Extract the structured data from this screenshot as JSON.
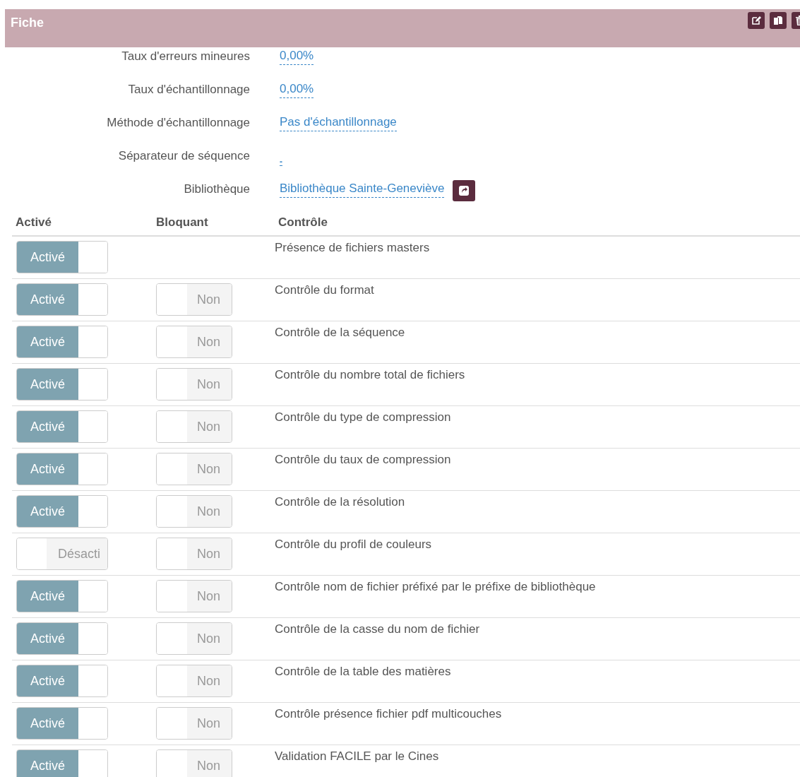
{
  "panel": {
    "title": "Fiche"
  },
  "fields": [
    {
      "label": "Taux d'erreurs mineures",
      "value": "0,00%",
      "has_button": false
    },
    {
      "label": "Taux d'échantillonnage",
      "value": "0,00%",
      "has_button": false
    },
    {
      "label": "Méthode d'échantillonnage",
      "value": "Pas d'échantillonnage",
      "has_button": false
    },
    {
      "label": "Séparateur de séquence",
      "value": "-",
      "has_button": false
    },
    {
      "label": "Bibliothèque",
      "value": "Bibliothèque Sainte-Geneviève",
      "has_button": true
    }
  ],
  "table": {
    "columns": [
      "Activé",
      "Bloquant",
      "Contrôle"
    ],
    "rows": [
      {
        "active": {
          "on": true,
          "label": "Activé"
        },
        "control": "Présence de fichiers masters"
      },
      {
        "active": {
          "on": true,
          "label": "Activé"
        },
        "blocking": {
          "on": false,
          "label": "Non"
        },
        "control": "Contrôle du format"
      },
      {
        "active": {
          "on": true,
          "label": "Activé"
        },
        "blocking": {
          "on": false,
          "label": "Non"
        },
        "control": "Contrôle de la séquence"
      },
      {
        "active": {
          "on": true,
          "label": "Activé"
        },
        "blocking": {
          "on": false,
          "label": "Non"
        },
        "control": "Contrôle du nombre total de fichiers"
      },
      {
        "active": {
          "on": true,
          "label": "Activé"
        },
        "blocking": {
          "on": false,
          "label": "Non"
        },
        "control": "Contrôle du type de compression"
      },
      {
        "active": {
          "on": true,
          "label": "Activé"
        },
        "blocking": {
          "on": false,
          "label": "Non"
        },
        "control": "Contrôle du taux de compression"
      },
      {
        "active": {
          "on": true,
          "label": "Activé"
        },
        "blocking": {
          "on": false,
          "label": "Non"
        },
        "control": "Contrôle de la résolution"
      },
      {
        "active": {
          "on": false,
          "label": "Désacti"
        },
        "blocking": {
          "on": false,
          "label": "Non"
        },
        "control": "Contrôle du profil de couleurs"
      },
      {
        "active": {
          "on": true,
          "label": "Activé"
        },
        "blocking": {
          "on": false,
          "label": "Non"
        },
        "control": "Contrôle nom de fichier préfixé par le préfixe de bibliothèque"
      },
      {
        "active": {
          "on": true,
          "label": "Activé"
        },
        "blocking": {
          "on": false,
          "label": "Non"
        },
        "control": "Contrôle de la casse du nom de fichier"
      },
      {
        "active": {
          "on": true,
          "label": "Activé"
        },
        "blocking": {
          "on": false,
          "label": "Non"
        },
        "control": "Contrôle de la table des matières"
      },
      {
        "active": {
          "on": true,
          "label": "Activé"
        },
        "blocking": {
          "on": false,
          "label": "Non"
        },
        "control": "Contrôle présence fichier pdf multicouches"
      },
      {
        "active": {
          "on": true,
          "label": "Activé"
        },
        "blocking": {
          "on": false,
          "label": "Non"
        },
        "control": "Validation FACILE par le Cines"
      }
    ]
  }
}
